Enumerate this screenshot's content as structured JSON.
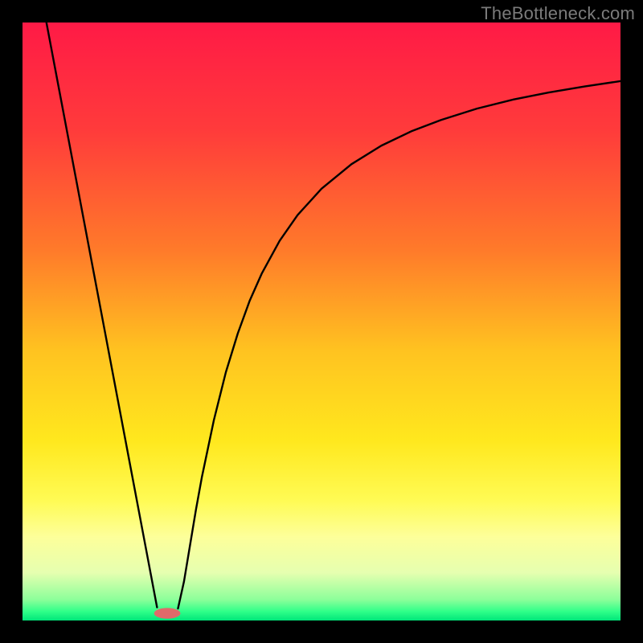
{
  "watermark": "TheBottleneck.com",
  "chart_data": {
    "type": "line",
    "title": "",
    "xlabel": "",
    "ylabel": "",
    "xlim": [
      0,
      100
    ],
    "ylim": [
      0,
      100
    ],
    "grid": false,
    "gradient_stops": [
      {
        "offset": 0.0,
        "color": "#ff1a46"
      },
      {
        "offset": 0.18,
        "color": "#ff3b3b"
      },
      {
        "offset": 0.38,
        "color": "#ff7a2a"
      },
      {
        "offset": 0.55,
        "color": "#ffc320"
      },
      {
        "offset": 0.7,
        "color": "#ffe81e"
      },
      {
        "offset": 0.8,
        "color": "#fffb55"
      },
      {
        "offset": 0.86,
        "color": "#fdff9a"
      },
      {
        "offset": 0.92,
        "color": "#e6ffb0"
      },
      {
        "offset": 0.965,
        "color": "#8cff9a"
      },
      {
        "offset": 0.985,
        "color": "#2fff89"
      },
      {
        "offset": 1.0,
        "color": "#00e57a"
      }
    ],
    "series": [
      {
        "name": "left-line",
        "type": "segment",
        "x": [
          4.0,
          22.5
        ],
        "y": [
          100.0,
          2.2
        ]
      },
      {
        "name": "right-curve",
        "type": "curve",
        "x": [
          26.0,
          27.0,
          28.0,
          29.0,
          30.0,
          32.0,
          34.0,
          36.0,
          38.0,
          40.0,
          43.0,
          46.0,
          50.0,
          55.0,
          60.0,
          65.0,
          70.0,
          76.0,
          82.0,
          88.0,
          94.0,
          100.0
        ],
        "y": [
          2.0,
          6.5,
          12.5,
          18.5,
          24.0,
          33.5,
          41.5,
          48.0,
          53.5,
          58.0,
          63.5,
          67.8,
          72.2,
          76.3,
          79.4,
          81.8,
          83.7,
          85.6,
          87.1,
          88.3,
          89.3,
          90.2
        ]
      }
    ],
    "marker": {
      "name": "bottom-marker",
      "cx": 24.2,
      "cy": 1.2,
      "rx": 2.2,
      "ry": 0.9,
      "fill": "#e06a6a"
    }
  }
}
